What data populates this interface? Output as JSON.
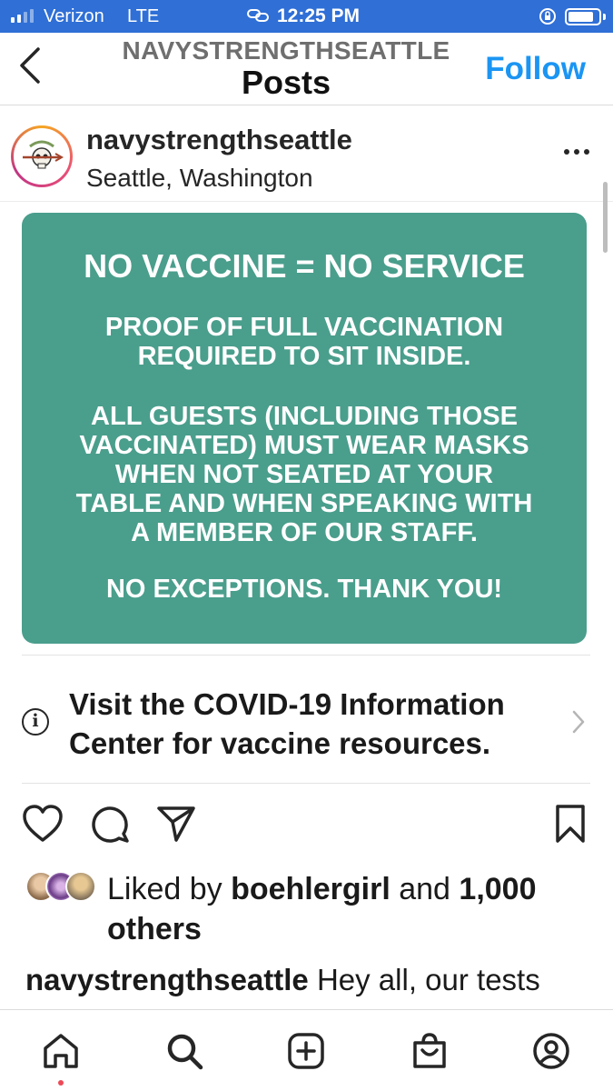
{
  "status_bar": {
    "carrier": "Verizon",
    "network": "LTE",
    "time": "12:25 PM",
    "battery_level": 0.85,
    "signal_bars": 2
  },
  "header": {
    "username": "NAVYSTRENGTHSEATTLE",
    "title": "Posts",
    "follow_label": "Follow",
    "back_icon": "chevron-left-icon"
  },
  "post": {
    "username": "navystrengthseattle",
    "location": "Seattle, Washington",
    "more_icon": "more-options-icon",
    "image": {
      "background_color": "#4a9e8c",
      "headline": "NO VACCINE = NO SERVICE",
      "paragraph1": [
        "PROOF OF FULL VACCINATION",
        "REQUIRED TO SIT INSIDE."
      ],
      "paragraph2": [
        "ALL GUESTS (INCLUDING THOSE",
        "VACCINATED) MUST WEAR MASKS",
        "WHEN NOT SEATED AT YOUR",
        "TABLE AND WHEN SPEAKING WITH",
        "A MEMBER OF OUR STAFF."
      ],
      "paragraph3": "NO EXCEPTIONS. THANK YOU!"
    },
    "covid_banner": {
      "text": "Visit the COVID-19 Information Center for vaccine resources.",
      "icon": "info-icon"
    },
    "actions": [
      "heart-icon",
      "comment-icon",
      "share-icon",
      "bookmark-icon"
    ],
    "likes": {
      "prefix": "Liked by ",
      "user": "boehlergirl",
      "middle": " and ",
      "count": "1,000",
      "suffix": "others"
    },
    "caption": {
      "username": "navystrengthseattle",
      "text": " Hey all, our tests"
    }
  },
  "tab_bar": [
    "home-icon",
    "search-icon",
    "new-post-icon",
    "shop-icon",
    "profile-icon"
  ],
  "colors": {
    "accent": "#1b95f3",
    "status_bar": "#2f6fd6",
    "notification_dot": "#ed4956"
  }
}
